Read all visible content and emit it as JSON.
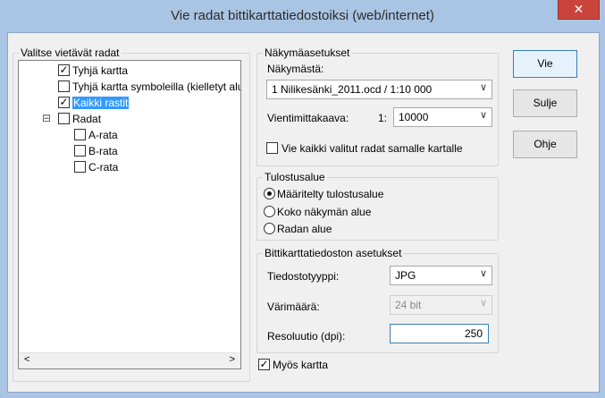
{
  "window": {
    "title": "Vie radat bittikarttatiedostoiksi (web/internet)",
    "close_glyph": "✕"
  },
  "left_group": {
    "title": "Valitse vietävät radat",
    "items": [
      {
        "label": "Tyhjä kartta",
        "checked": true
      },
      {
        "label": "Tyhjä kartta symboleilla (kielletyt alu",
        "checked": false
      },
      {
        "label": "Kaikki rastit",
        "checked": true
      },
      {
        "label": "Radat",
        "checked": false,
        "expander": "⊟"
      },
      {
        "label": "A-rata",
        "checked": false
      },
      {
        "label": "B-rata",
        "checked": false
      },
      {
        "label": "C-rata",
        "checked": false
      }
    ],
    "scroll_left": "<",
    "scroll_right": ">"
  },
  "view_settings": {
    "title": "Näkymäasetukset",
    "from_view_label": "Näkymästä:",
    "from_view_value": "1 Nilikesänki_2011.ocd   / 1:10 000",
    "scale_label": "Vientimittakaava:",
    "scale_prefix": "1:",
    "scale_value": "10000",
    "same_map_label": "Vie kaikki valitut radat samalle kartalle",
    "same_map_checked": false
  },
  "output_area": {
    "title": "Tulostusalue",
    "options": [
      {
        "label": "Määritelty tulostusalue",
        "selected": true
      },
      {
        "label": "Koko näkymän alue",
        "selected": false
      },
      {
        "label": "Radan alue",
        "selected": false
      }
    ]
  },
  "bitmap_settings": {
    "title": "Bittikarttatiedoston asetukset",
    "filetype_label": "Tiedostotyyppi:",
    "filetype_value": "JPG",
    "colors_label": "Värimäärä:",
    "colors_value": "24 bit",
    "resolution_label": "Resoluutio (dpi):",
    "resolution_value": "250"
  },
  "also_map": {
    "label": "Myös kartta",
    "checked": true
  },
  "buttons": {
    "export": "Vie",
    "close": "Sulje",
    "help": "Ohje"
  },
  "glyphs": {
    "check": "✓",
    "dropdown": "∨"
  },
  "colors": {
    "title_bar": "#a9c5e3",
    "close_button": "#c9453c",
    "selection": "#3399ff"
  }
}
